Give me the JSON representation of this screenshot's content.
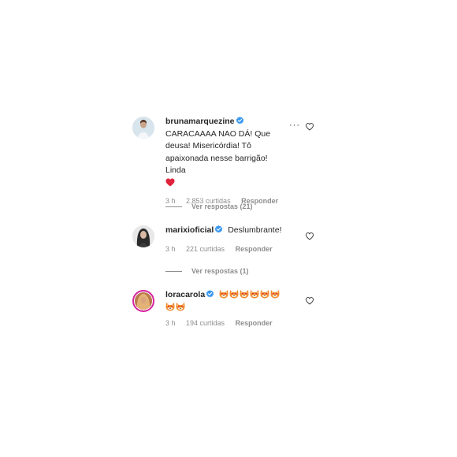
{
  "comments": [
    {
      "username": "brunamarquezine",
      "text": "CARACAAAA NAO DÁ! Que deusa! Misericórdia! Tô apaixonada nesse barrigão! Linda",
      "time": "3 h",
      "likes": "2.853 curtidas",
      "reply": "Responder",
      "view_replies": "Ver respostas (21)",
      "trailing_emoji": "red-heart"
    },
    {
      "username": "marixioficial",
      "text": "Deslumbrante!",
      "time": "3 h",
      "likes": "221 curtidas",
      "reply": "Responder",
      "view_replies": "Ver respostas (1)"
    },
    {
      "username": "loracarola",
      "text": "",
      "emoji": "fox-face-heart-eyes",
      "emoji_count": 8,
      "time": "3 h",
      "likes": "194 curtidas",
      "reply": "Responder"
    }
  ],
  "more_options": "···",
  "colors": {
    "verified": "#3897f0",
    "muted": "#8e8e8e",
    "text": "#262626",
    "heart_red": "#ed4956"
  }
}
